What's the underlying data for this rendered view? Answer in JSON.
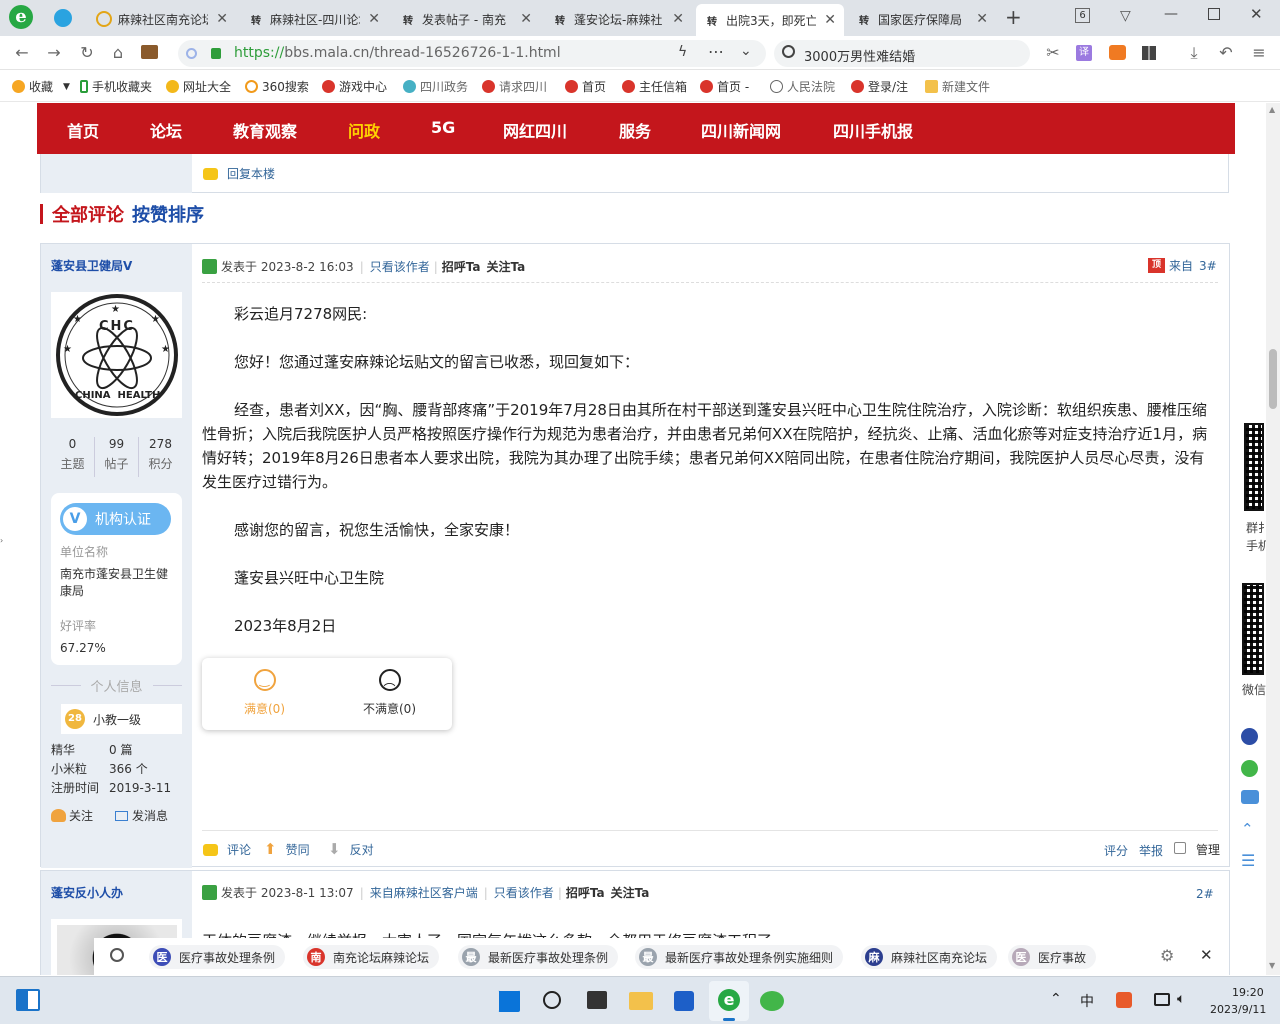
{
  "browser": {
    "tab_count_badge": "6",
    "tabs": [
      {
        "title": "麻辣社区南充论坛",
        "icon": "globe-icon"
      },
      {
        "title": "麻辣社区-四川论坛",
        "icon": "ma-icon"
      },
      {
        "title": "发表帖子 - 南充",
        "icon": "ma-icon"
      },
      {
        "title": "蓬安论坛-麻辣社",
        "icon": "ma-icon"
      },
      {
        "title": "出院3天，即死亡",
        "icon": "ma-icon"
      },
      {
        "title": "国家医疗保障局",
        "icon": "ma-icon"
      }
    ],
    "url": "https://bbs.mala.cn/thread-16526726-1-1.html",
    "url_scheme": "https://",
    "url_rest": "bbs.mala.cn/thread-16526726-1-1.html",
    "search_text": "3000万男性难结婚",
    "bookmarks": [
      "收藏",
      "手机收藏夹",
      "网址大全",
      "360搜索",
      "游戏中心",
      "四川政务",
      "请求四川",
      "首页",
      "主任信箱",
      "首页 -",
      "人民法院",
      "登录/注",
      "新建文件"
    ]
  },
  "site_nav": [
    "首页",
    "论坛",
    "教育观察",
    "问政",
    "5G",
    "网红四川",
    "服务",
    "四川新闻网",
    "四川手机报"
  ],
  "reply_this_floor": "回复本楼",
  "comments_header": {
    "all": "全部评论",
    "sort": "按赞排序"
  },
  "post1": {
    "author": "蓬安县卫健局V",
    "avatar_text": {
      "top": "CHC",
      "bottom": "CHINA  HEALTH"
    },
    "stats": [
      {
        "num": "0",
        "label": "主题"
      },
      {
        "num": "99",
        "label": "帖子"
      },
      {
        "num": "278",
        "label": "积分"
      }
    ],
    "cert_label": "机构认证",
    "unit_label": "单位名称",
    "unit_name": "南充市蓬安县卫生健康局",
    "rating_label": "好评率",
    "rating_value": "67.27%",
    "personal_info": "个人信息",
    "level_num": "28",
    "level_name": "小教一级",
    "info": [
      {
        "k": "精华",
        "v": "0 篇"
      },
      {
        "k": "小米粒",
        "v": "366 个"
      },
      {
        "k": "注册时间",
        "v": "2019-3-11"
      }
    ],
    "follow": "关注",
    "message": "发消息",
    "posted_at": "发表于 2023-8-2 16:03",
    "only_author": "只看该作者",
    "greet": "招呼Ta",
    "follow_ta": "关注Ta",
    "from_label": "来自",
    "floor": "3#",
    "body": [
      "彩云追月7278网民:",
      "您好！您通过蓬安麻辣论坛贴文的留言已收悉，现回复如下：",
      "经查，患者刘XX，因“胸、腰背部疼痛”于2019年7月28日由其所在村干部送到蓬安县兴旺中心卫生院住院治疗，入院诊断：软组织疾患、腰椎压缩性骨折；入院后我院医护人员严格按照医疗操作行为规范为患者治疗，并由患者兄弟何XX在院陪护，经抗炎、止痛、活血化瘀等对症支持治疗近1月，病情好转；2019年8月26日患者本人要求出院，我院为其办理了出院手续；患者兄弟何XX陪同出院，在患者住院治疗期间，我院医护人员尽心尽责，没有发生医疗过错行为。",
      "感谢您的留言，祝您生活愉快，全家安康！",
      "蓬安县兴旺中心卫生院",
      "2023年8月2日"
    ],
    "satisfied": "满意(0)",
    "unsatisfied": "不满意(0)",
    "actions": {
      "comment": "评论",
      "like": "赞同",
      "oppose": "反对",
      "rate": "评分",
      "report": "举报",
      "manage": "管理"
    }
  },
  "post2": {
    "author": "蓬安反小人办",
    "posted_at": "发表于 2023-8-1 13:07",
    "client": "来自麻辣社区客户端",
    "only_author": "只看该作者",
    "greet": "招呼Ta",
    "follow_ta": "关注Ta",
    "floor": "2#",
    "body_partial": "干体的豆腐渣，继续举报，太害人了，国家每年拨这么多款，全都用于修豆腐渣工程了"
  },
  "side_widgets": {
    "qr1": "群扌",
    "qr1b": "手机",
    "qr2": "微信"
  },
  "bottom_tags": [
    {
      "label": "医疗事故处理条例",
      "color": "#3d4db7",
      "glyph": "医"
    },
    {
      "label": "南充论坛麻辣论坛",
      "color": "#d9342b",
      "glyph": "南"
    },
    {
      "label": "最新医疗事故处理条例",
      "color": "#9aa3ad",
      "glyph": "最"
    },
    {
      "label": "最新医疗事故处理条例实施细则",
      "color": "#9aa3ad",
      "glyph": "最"
    },
    {
      "label": "麻辣社区南充论坛",
      "color": "#2c3e8f",
      "glyph": "麻"
    },
    {
      "label": "医疗事故",
      "color": "#b7a9b9",
      "glyph": "医"
    }
  ],
  "taskbar": {
    "ime": "中",
    "time": "19:20",
    "date": "2023/9/11"
  }
}
